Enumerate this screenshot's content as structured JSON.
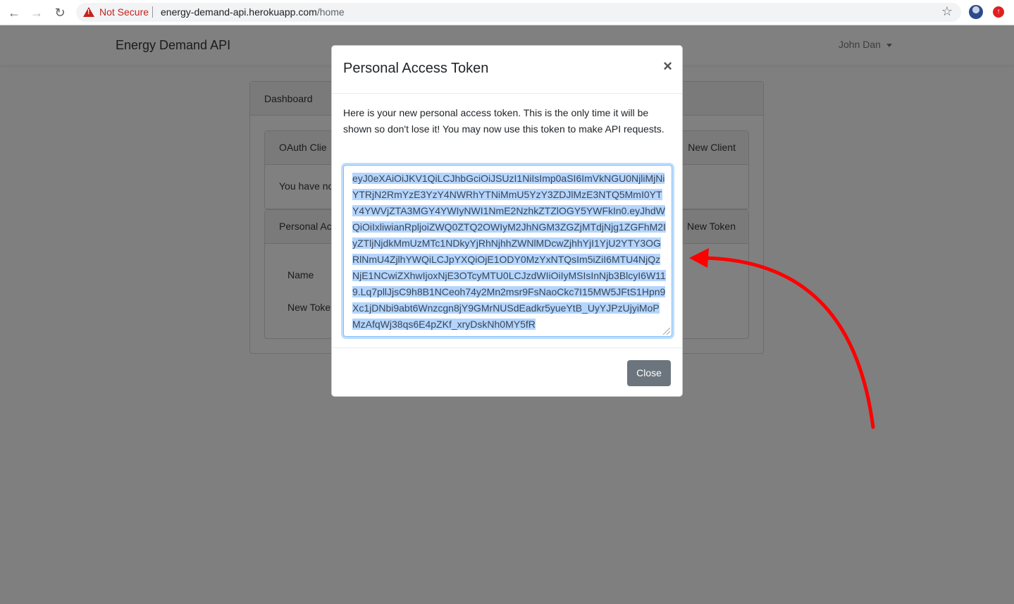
{
  "browser": {
    "security_label": "Not Secure",
    "url_host": "energy-demand-api.herokuapp.com",
    "url_path": "/home"
  },
  "page": {
    "brand": "Energy Demand API",
    "user_name": "John Dan",
    "card_title": "Dashboard",
    "oauth_title": "OAuth Clie",
    "oauth_link": "New Client",
    "oauth_empty": "You have no",
    "pat_title": "Personal Ac",
    "pat_link": "New Token",
    "name_label": "Name",
    "new_token_label": "New Toke"
  },
  "modal": {
    "title": "Personal Access Token",
    "close_symbol": "×",
    "message": "Here is your new personal access token. This is the only time it will be shown so don't lose it! You may now use this token to make API requests.",
    "token": "eyJ0eXAiOiJKV1QiLCJhbGciOiJSUzI1NiIsImp0aSI6ImVkNGU0NjliMjNiYTRjN2RmYzE3YzY4NWRhYTNiMmU5YzY3ZDJlMzE3NTQ5MmI0YTY4YWVjZTA3MGY4YWIyNWI1NmE2NzhkZTZlOGY5YWFkIn0.eyJhdWQiOiIxliwianRpljoiZWQ0ZTQ2OWIyM2JhNGM3ZGZjMTdjNjg1ZGFhM2IyZTljNjdkMmUzMTc1NDkyYjRhNjhhZWNlMDcwZjhhYjI1YjU2YTY3OGRlNmU4ZjlhYWQiLCJpYXQiOjE1ODY0MzYxNTQsIm5iZiI6MTU4NjQzNjE1NCwiZXhwIjoxNjE3OTcyMTU0LCJzdWIiOiIyMSIsInNjb3BlcyI6W119.Lq7pllJjsC9h8B1NCeoh74y2Mn2msr9FsNaoCkc7I15MW5JFtS1Hpn9Xc1jDNbi9abt6Wnzcgn8jY9GMrNUSdEadkr5yueYtB_UyYJPzUjyiMoPMzAfqWj38qs6E4pZKf_xryDskNh0MY5fR",
    "close_button": "Close"
  },
  "colors": {
    "overlay": "#7f7f7f",
    "selection": "#b4d5fe",
    "arrow": "#ff0000",
    "close_button": "#6c757d"
  }
}
